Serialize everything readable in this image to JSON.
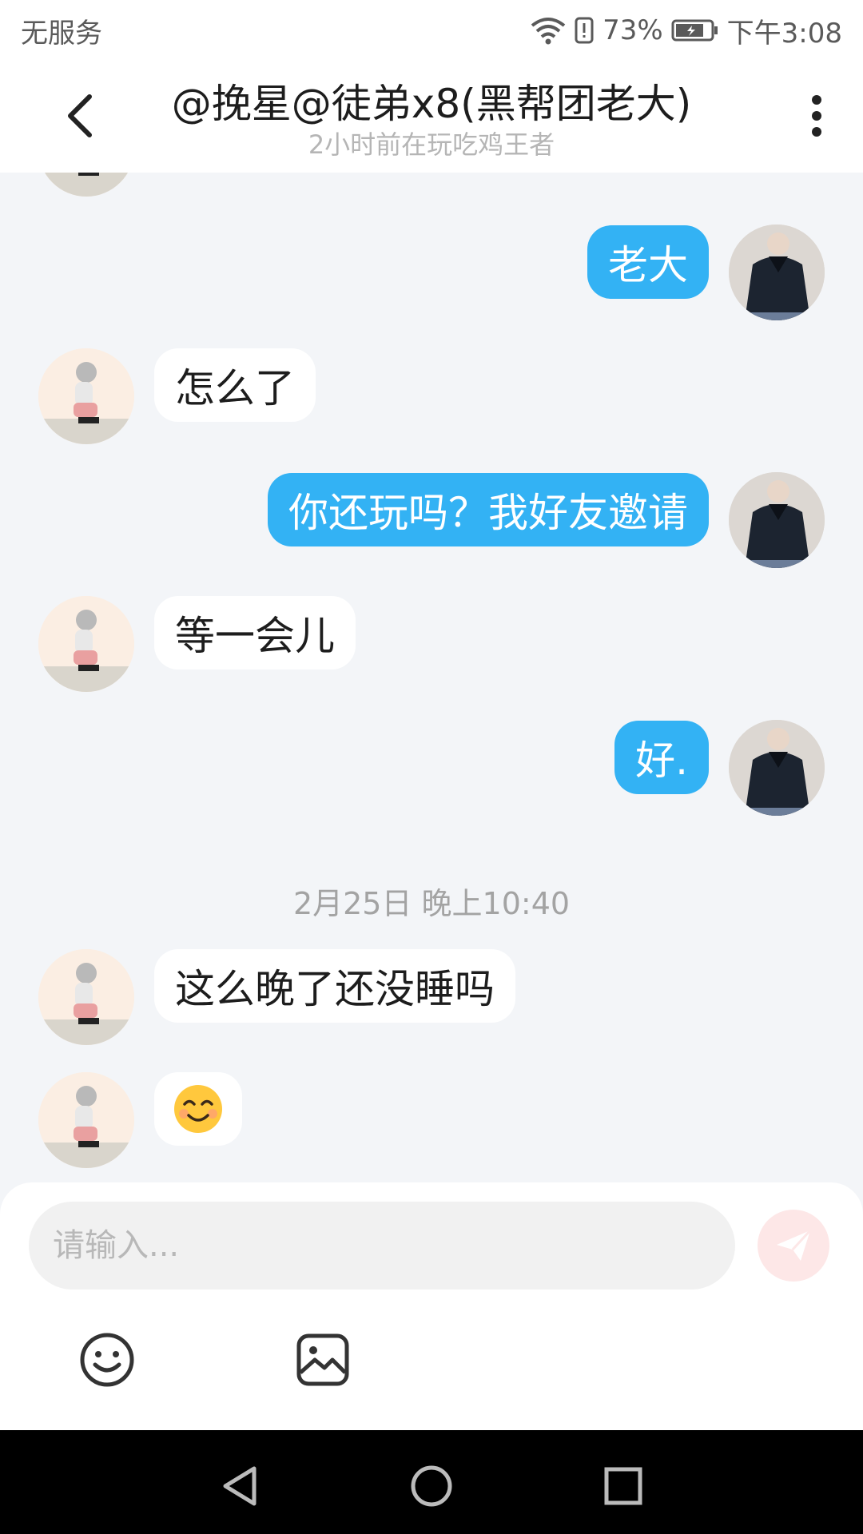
{
  "status_bar": {
    "carrier": "无服务",
    "battery_percent": "73%",
    "time": "下午3:08"
  },
  "header": {
    "title": "@挽星@徒弟x8(黑帮团老大)",
    "subtitle": "2小时前在玩吃鸡王者"
  },
  "messages": [
    {
      "from": "me",
      "text": "老大"
    },
    {
      "from": "them",
      "text": "怎么了"
    },
    {
      "from": "me",
      "text": "你还玩吗？我好友邀请"
    },
    {
      "from": "them",
      "text": "等一会儿"
    },
    {
      "from": "me",
      "text": "好."
    }
  ],
  "timestamp": "2月25日 晚上10:40",
  "messages_after": [
    {
      "from": "them",
      "text": "这么晚了还没睡吗"
    },
    {
      "from": "them",
      "emoji": "smiling-face"
    }
  ],
  "input": {
    "placeholder": "请输入..."
  },
  "colors": {
    "my_bubble": "#33b2f4",
    "their_bubble": "#ffffff",
    "background": "#f3f5f8",
    "send_button": "#fde7e7"
  }
}
